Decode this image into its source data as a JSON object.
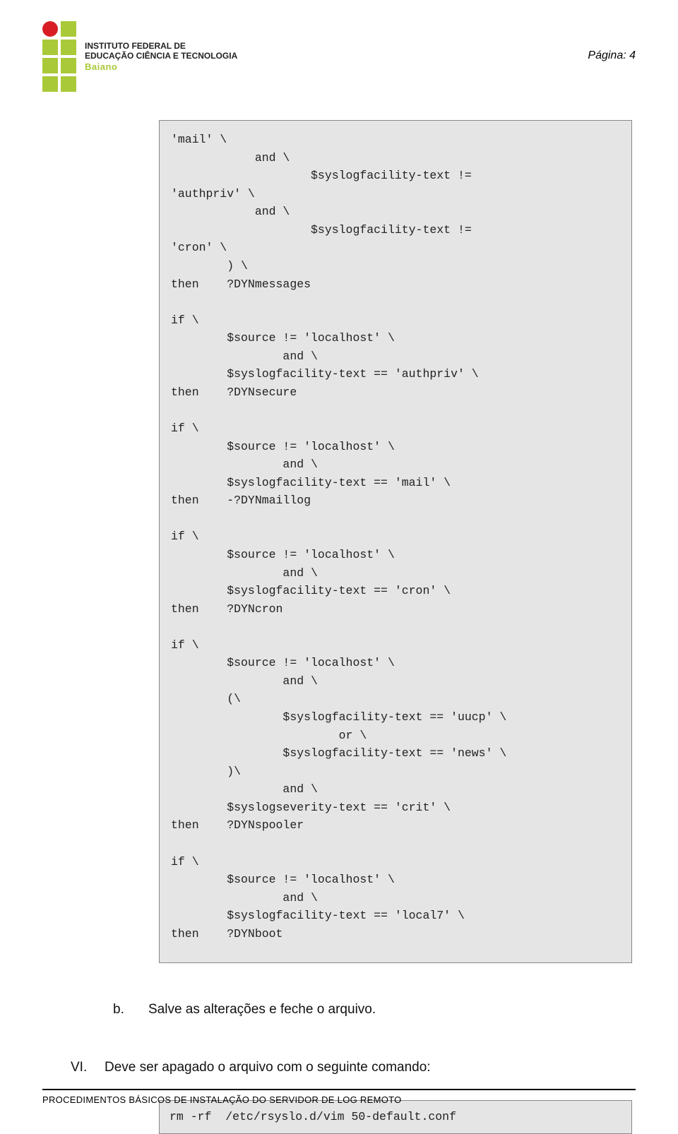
{
  "header": {
    "page_label": "Página: 4",
    "logo_line1": "INSTITUTO FEDERAL DE",
    "logo_line2": "EDUCAÇÃO CIÊNCIA E TECNOLOGIA",
    "logo_line3": "Baiano"
  },
  "code": "'mail' \\\n            and \\\n                    $syslogfacility-text !=\n'authpriv' \\\n            and \\\n                    $syslogfacility-text !=\n'cron' \\\n        ) \\\nthen    ?DYNmessages\n\nif \\\n        $source != 'localhost' \\\n                and \\\n        $syslogfacility-text == 'authpriv' \\\nthen    ?DYNsecure\n\nif \\\n        $source != 'localhost' \\\n                and \\\n        $syslogfacility-text == 'mail' \\\nthen    -?DYNmaillog\n\nif \\\n        $source != 'localhost' \\\n                and \\\n        $syslogfacility-text == 'cron' \\\nthen    ?DYNcron\n\nif \\\n        $source != 'localhost' \\\n                and \\\n        (\\\n                $syslogfacility-text == 'uucp' \\\n                        or \\\n                $syslogfacility-text == 'news' \\\n        )\\\n                and \\\n        $syslogseverity-text == 'crit' \\\nthen    ?DYNspooler\n\nif \\\n        $source != 'localhost' \\\n                and \\\n        $syslogfacility-text == 'local7' \\\nthen    ?DYNboot",
  "step_b": {
    "marker": "b.",
    "text": "Salve as alterações e feche o arquivo."
  },
  "section_vi": {
    "marker": "VI.",
    "text": "Deve ser apagado o arquivo com o seguinte comando:"
  },
  "command": "rm -rf  /etc/rsyslo.d/vim 50-default.conf",
  "footer": "PROCEDIMENTOS BÁSICOS DE INSTALAÇÃO DO SERVIDOR DE LOG REMOTO"
}
